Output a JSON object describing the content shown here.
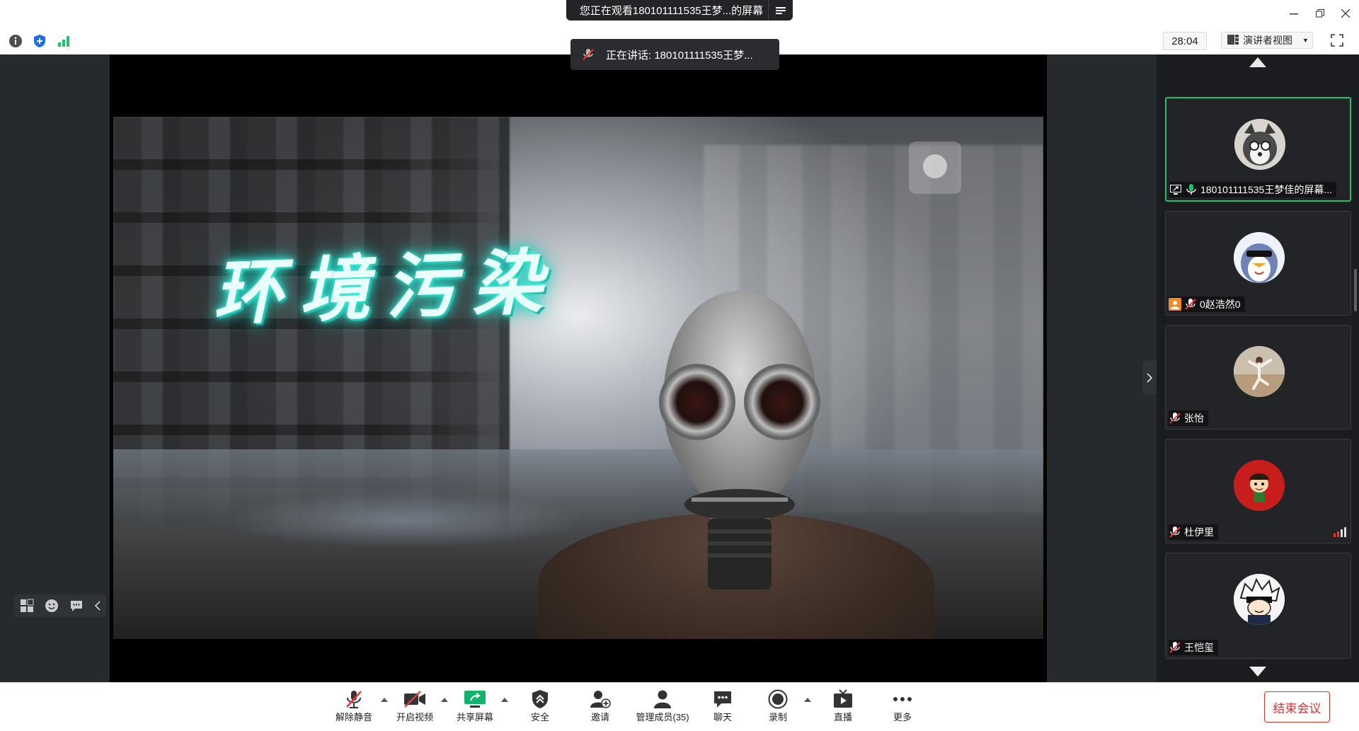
{
  "titlebar": {
    "sharing_notice": "您正在观看180101111535王梦...的屏幕",
    "window_controls": [
      "minimize-icon",
      "restore-icon",
      "close-icon"
    ]
  },
  "topbar": {
    "left_icons": [
      "info-icon",
      "shield-icon",
      "signal-bars-icon"
    ],
    "timer": "28:04",
    "view_label": "演讲者视图",
    "fullscreen_icon": "fullscreen-icon"
  },
  "toast": {
    "speaking": "正在讲话: 180101111535王梦..."
  },
  "slide": {
    "title": "环境污染"
  },
  "participants": [
    {
      "name": "180101111535王梦佳的屏幕...",
      "avatar": "husky-avatar",
      "active": true,
      "icons": [
        "screen-share-icon",
        "mic-on-icon"
      ]
    },
    {
      "name": "赵浩然",
      "name_full": "0赵浩然0",
      "avatar": "penguin-avatar",
      "active": false,
      "icons": [
        "host-icon",
        "mic-muted-icon"
      ]
    },
    {
      "name": "张怡",
      "avatar": "dancer-avatar",
      "active": false,
      "icons": [
        "mic-muted-icon"
      ]
    },
    {
      "name": "杜伊里",
      "avatar": "cartoon-avatar",
      "active": false,
      "icons": [
        "mic-muted-icon"
      ],
      "weak_signal": true
    },
    {
      "name": "王恺玺",
      "avatar": "anime-avatar",
      "active": false,
      "icons": [
        "mic-muted-icon"
      ]
    }
  ],
  "bottom": {
    "buttons": [
      {
        "label": "解除静音",
        "icon": "mic-muted-icon"
      },
      {
        "label": "开启视频",
        "icon": "video-off-icon"
      },
      {
        "label": "共享屏幕",
        "icon": "share-screen-icon"
      },
      {
        "label": "安全",
        "icon": "security-icon"
      },
      {
        "label": "邀请",
        "icon": "invite-icon"
      },
      {
        "label": "管理成员(35)",
        "icon": "members-icon"
      },
      {
        "label": "聊天",
        "icon": "chat-icon"
      },
      {
        "label": "录制",
        "icon": "record-icon"
      },
      {
        "label": "直播",
        "icon": "live-icon"
      },
      {
        "label": "更多",
        "icon": "more-icon"
      }
    ],
    "end_meeting": "结束会议"
  },
  "colors": {
    "accent_green": "#1ec26a",
    "danger_red": "#e0302d",
    "title_glow": "#3ff2dc"
  }
}
